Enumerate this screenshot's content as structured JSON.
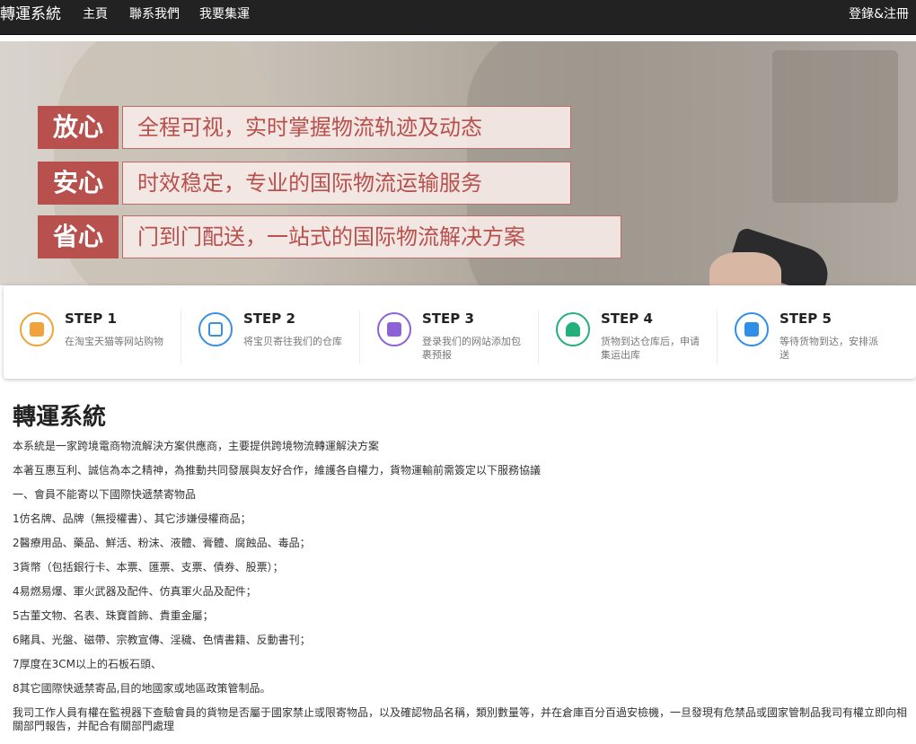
{
  "navbar": {
    "brand": "轉運系統",
    "links": [
      "主頁",
      "聯系我們",
      "我要集運"
    ],
    "login": "登錄&注冊"
  },
  "banner": {
    "slogans": [
      {
        "tag": "放心",
        "text": "全程可视，实时掌握物流轨迹及动态"
      },
      {
        "tag": "安心",
        "text": "时效稳定，专业的国际物流运输服务"
      },
      {
        "tag": "省心",
        "text": "门到门配送，一站式的国际物流解决方案"
      }
    ]
  },
  "steps": [
    {
      "title": "STEP 1",
      "desc": "在淘宝天猫等网站购物",
      "icon": "shopping-bag-icon",
      "color": "#f0a33a"
    },
    {
      "title": "STEP 2",
      "desc": "将宝贝寄往我们的仓库",
      "icon": "edit-document-icon",
      "color": "#3b8fe0"
    },
    {
      "title": "STEP 3",
      "desc": "登录我们的网站添加包裹预报",
      "icon": "wallet-icon",
      "color": "#8b62d8"
    },
    {
      "title": "STEP 4",
      "desc": "货物到达仓库后，申请集运出库",
      "icon": "warehouse-truck-icon",
      "color": "#23b07d"
    },
    {
      "title": "STEP 5",
      "desc": "等待货物到达，安排派送",
      "icon": "clipboard-check-icon",
      "color": "#2f8fe8"
    }
  ],
  "content": {
    "title": "轉運系統",
    "paragraphs": [
      "本系統是一家跨境電商物流解決方案供應商，主要提供跨境物流轉運解決方案",
      "本著互惠互利、誠信為本之精神，為推動共同發展與友好合作，維護各自權力，貨物運輸前需簽定以下服務協議",
      "一、會員不能寄以下國際快遞禁寄物品",
      "1仿名牌、品牌（無授權書）、其它涉嫌侵權商品；",
      "2醫療用品、藥品、鮮活、粉沫、液體、膏體、腐蝕品、毒品；",
      "3貨幣（包括銀行卡、本票、匯票、支票、債券、股票）；",
      "4易燃易爆、軍火武器及配件、仿真軍火品及配件；",
      "5古董文物、名表、珠寶首飾、貴重金屬；",
      "6賭具、光盤、磁帶、宗教宣傳、淫穢、色情書籍、反動書刊；",
      "7厚度在3CM以上的石板石頭、",
      "8其它國際快遞禁寄品,目的地國家或地區政策管制品。",
      "我司工作人員有權在監視器下查驗會員的貨物是否屬于國家禁止或限寄物品，以及確認物品名稱，類別數量等，并在倉庫百分百過安檢機，一旦發現有危禁品或國家管制品我司有權立即向相關部門報告，并配合有關部門處理"
    ]
  }
}
